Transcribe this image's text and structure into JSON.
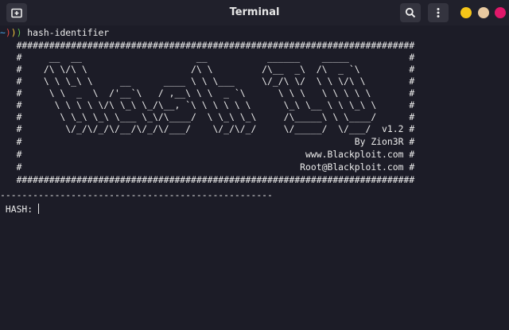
{
  "window": {
    "title": "Terminal",
    "new_tab_icon": "new-tab-icon",
    "search_icon": "search-icon",
    "menu_icon": "kebab-menu-icon",
    "controls": [
      {
        "name": "minimize",
        "color": "#f5c518"
      },
      {
        "name": "maximize",
        "color": "#e8c9a0"
      },
      {
        "name": "close",
        "color": "#e0186a"
      }
    ]
  },
  "terminal": {
    "prompt": {
      "tilde": "~",
      "chevrons": [
        ")",
        ")",
        ")"
      ],
      "command": " hash-identifier"
    },
    "banner": [
      "   #########################################################################",
      "   #     __  __                     __           ______    _____           #",
      "   #    /\\ \\/\\ \\                   /\\ \\         /\\__  _\\  /\\  _ `\\         #",
      "   #    \\ \\ \\_\\ \\     __      ____ \\ \\ \\___     \\/_/\\ \\/  \\ \\ \\/\\ \\        #",
      "   #     \\ \\  _  \\  /'__`\\   / ,__\\ \\ \\  _ `\\      \\ \\ \\   \\ \\ \\ \\ \\       #",
      "   #      \\ \\ \\ \\ \\/\\ \\_\\ \\_/\\__, `\\ \\ \\ \\ \\ \\      \\_\\ \\__ \\ \\ \\_\\ \\      #",
      "   #       \\ \\_\\ \\_\\ \\___ \\_\\/\\____/  \\ \\_\\ \\_\\     /\\_____\\ \\ \\____/      #",
      "   #        \\/_/\\/_/\\/__/\\/_/\\/___/    \\/_/\\/_/     \\/_____/  \\/___/  v1.2 #",
      "   #                                                             By Zion3R #",
      "   #                                                    www.Blackploit.com #",
      "   #                                                   Root@Blackploit.com #",
      "   #########################################################################"
    ],
    "separator": "--------------------------------------------------",
    "input_label": " HASH: ",
    "input_value": ""
  }
}
